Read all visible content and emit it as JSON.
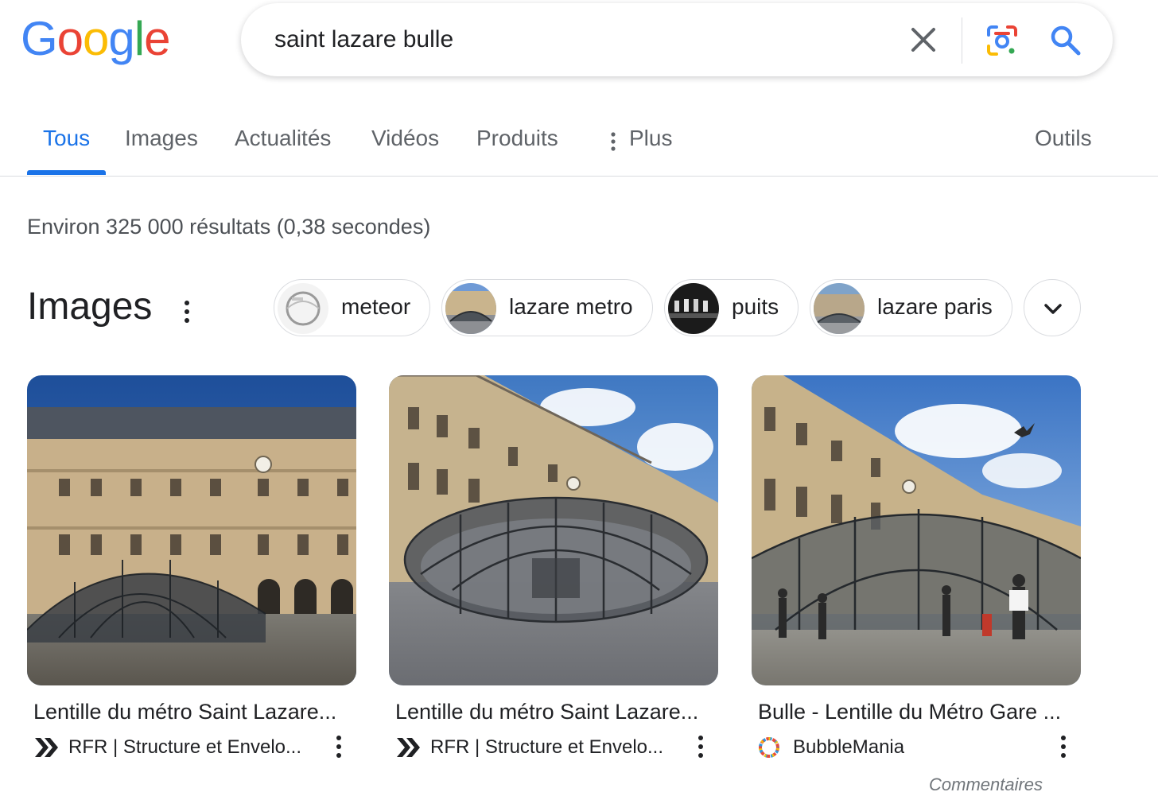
{
  "logo": {
    "letters": [
      "G",
      "o",
      "o",
      "g",
      "l",
      "e"
    ],
    "colors": [
      "#4285f4",
      "#ea4335",
      "#fbbc05",
      "#4285f4",
      "#34a853",
      "#ea4335"
    ]
  },
  "search": {
    "query": "saint lazare bulle"
  },
  "tabs": [
    {
      "label": "Tous",
      "active": true
    },
    {
      "label": "Images"
    },
    {
      "label": "Actualités"
    },
    {
      "label": "Vidéos"
    },
    {
      "label": "Produits"
    },
    {
      "label": "Plus"
    },
    {
      "label": "Outils"
    }
  ],
  "result_stats": "Environ 325 000 résultats (0,38 secondes)",
  "images_section": {
    "title": "Images",
    "chips": [
      {
        "label": "meteor"
      },
      {
        "label": "lazare metro"
      },
      {
        "label": "puits"
      },
      {
        "label": "lazare paris"
      }
    ],
    "cards": [
      {
        "title": "Lentille du métro Saint Lazare...",
        "source": "RFR | Structure et Envelo..."
      },
      {
        "title": "Lentille du métro Saint Lazare...",
        "source": "RFR | Structure et Envelo..."
      },
      {
        "title": "Bulle - Lentille du Métro Gare ...",
        "source": "BubbleMania"
      }
    ]
  },
  "feedback": "Commentaires",
  "colors": {
    "accent": "#1a73e8",
    "text": "#202124",
    "muted": "#5f6368",
    "border": "#dadce0"
  }
}
